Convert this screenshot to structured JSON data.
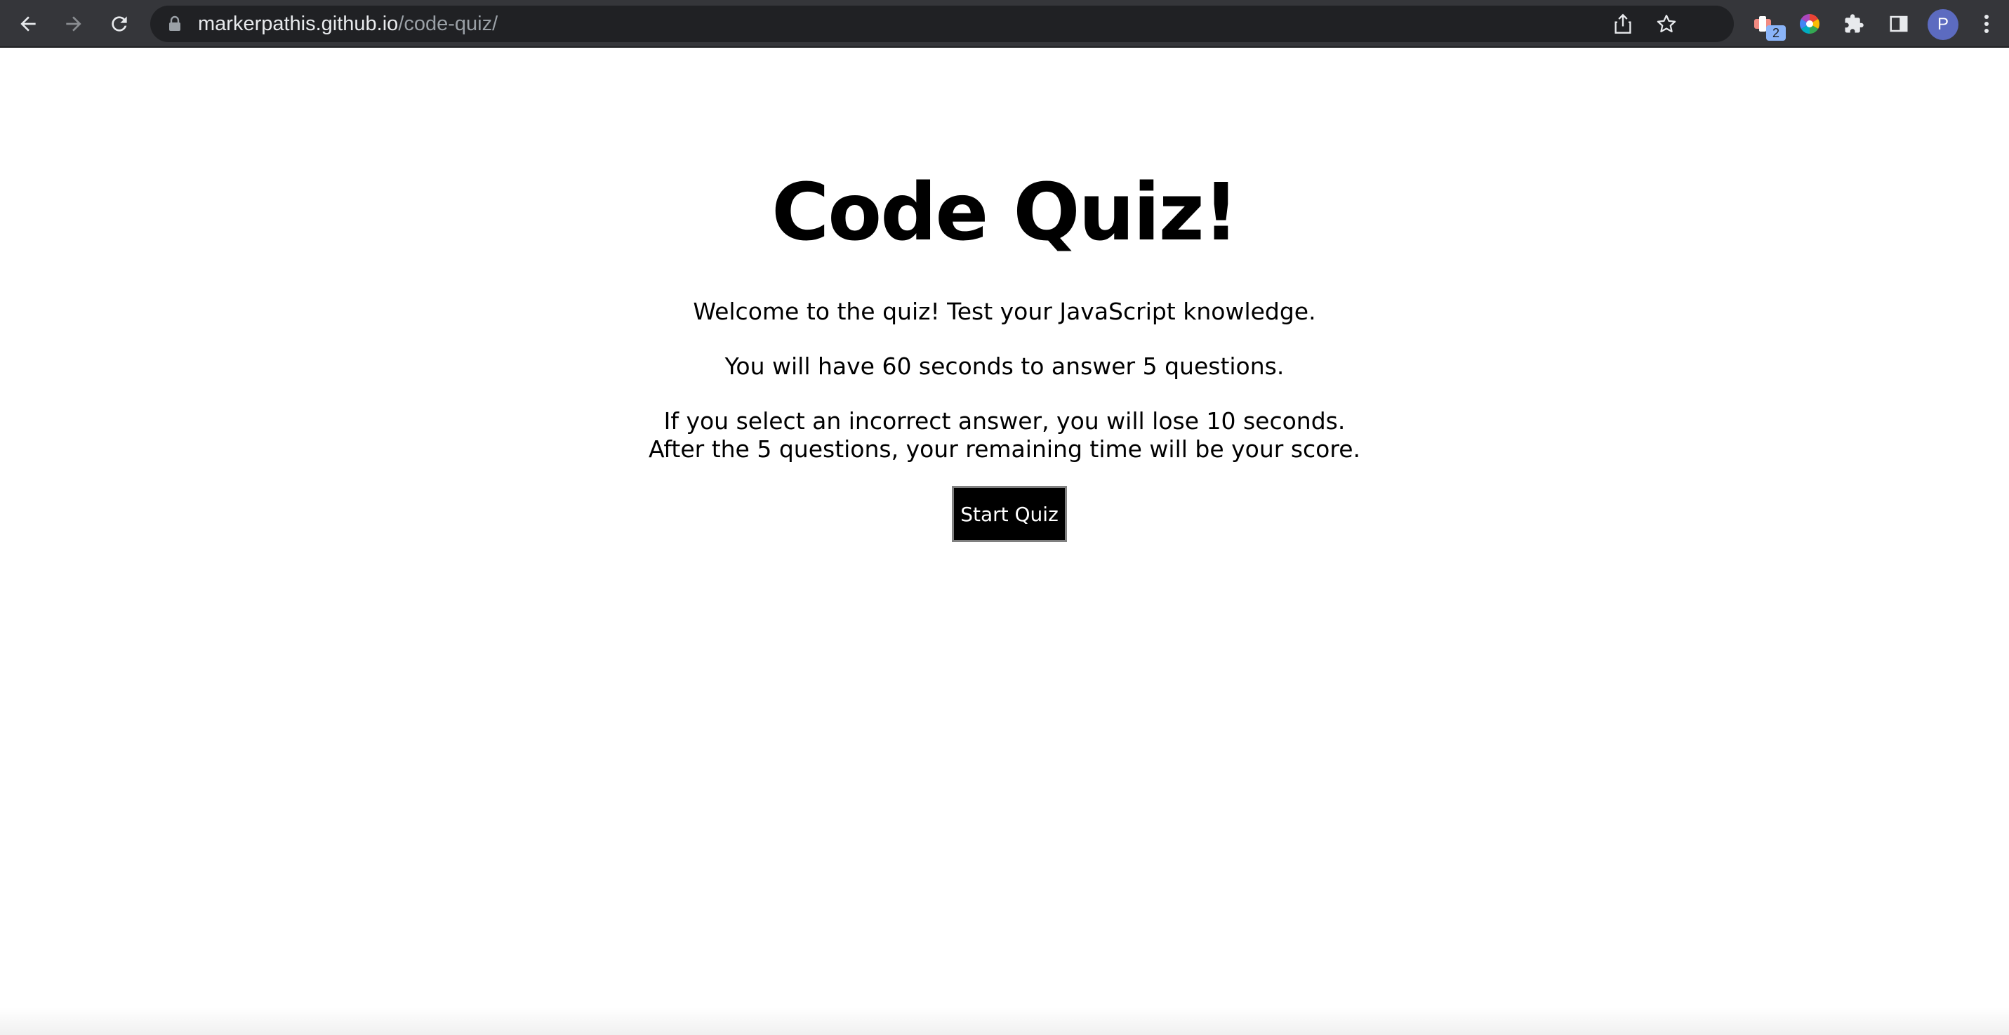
{
  "browser": {
    "url_host": "markerpathis.github.io",
    "url_path": "/code-quiz/",
    "extension_badge": "2",
    "profile_initial": "P",
    "icons": {
      "back": "arrow-left-icon",
      "forward": "arrow-right-icon",
      "reload": "reload-icon",
      "lock": "lock-icon",
      "share": "share-icon",
      "bookmark": "star-icon",
      "extension_one": "extension-badge-icon",
      "extension_two": "color-wheel-icon",
      "extensions_menu": "puzzle-icon",
      "side_panel": "side-panel-icon",
      "menu": "kebab-menu-icon"
    },
    "colors": {
      "toolbar": "#35363a",
      "omnibox": "#202124",
      "avatar": "#5c6bc0"
    }
  },
  "quiz": {
    "title": "Code Quiz!",
    "welcome": "Welcome to the quiz! Test your JavaScript knowledge.",
    "rules": "You will have 60 seconds to answer 5 questions.",
    "penalty": "If you select an incorrect answer, you will lose 10 seconds.",
    "scoring": "After the 5 questions, your remaining time will be your score.",
    "start_button": "Start Quiz"
  }
}
